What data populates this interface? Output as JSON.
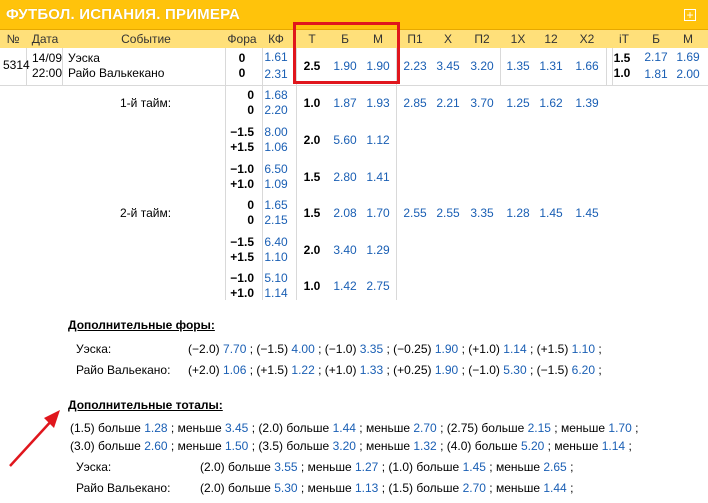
{
  "title": "ФУТБОЛ. ИСПАНИЯ. ПРИМЕРА",
  "header": [
    "№",
    "Дата",
    "Событие",
    "Фора",
    "КФ",
    "Т",
    "Б",
    "М",
    "П1",
    "Х",
    "П2",
    "1Х",
    "12",
    "Х2",
    "iT",
    "Б",
    "М"
  ],
  "event": {
    "id": "5314",
    "date": "14/09",
    "time": "22:00",
    "team1": "Уэска",
    "team2": "Райо Валькекано",
    "fora1": "0",
    "fora2": "0",
    "kf1": "1.61",
    "kf2": "2.31",
    "t": "2.5",
    "b": "1.90",
    "m": "1.90",
    "p1": "2.23",
    "x": "3.45",
    "p2": "3.20",
    "x1": "1.35",
    "x12": "1.31",
    "x2": "1.66",
    "it1": "1.5",
    "it2": "1.0",
    "ib1": "2.17",
    "ib2": "1.81",
    "im1": "1.69",
    "im2": "2.00"
  },
  "half1_label": "1-й тайм:",
  "half2_label": "2-й тайм:",
  "subrows": [
    {
      "f1": "0",
      "f2": "0",
      "k1": "1.68",
      "k2": "2.20",
      "t": "1.0",
      "b": "1.87",
      "m": "1.93",
      "p1": "2.85",
      "x": "2.21",
      "p2": "3.70",
      "x1": "1.25",
      "x12": "1.62",
      "x2": "1.39"
    },
    {
      "f1": "−1.5",
      "f2": "+1.5",
      "k1": "8.00",
      "k2": "1.06",
      "t": "2.0",
      "b": "5.60",
      "m": "1.12"
    },
    {
      "f1": "−1.0",
      "f2": "+1.0",
      "k1": "6.50",
      "k2": "1.09",
      "t": "1.5",
      "b": "2.80",
      "m": "1.41"
    },
    {
      "f1": "0",
      "f2": "0",
      "k1": "1.65",
      "k2": "2.15",
      "t": "1.5",
      "b": "2.08",
      "m": "1.70",
      "p1": "2.55",
      "x": "2.55",
      "p2": "3.35",
      "x1": "1.28",
      "x12": "1.45",
      "x2": "1.45"
    },
    {
      "f1": "−1.5",
      "f2": "+1.5",
      "k1": "6.40",
      "k2": "1.10",
      "t": "2.0",
      "b": "3.40",
      "m": "1.29"
    },
    {
      "f1": "−1.0",
      "f2": "+1.0",
      "k1": "5.10",
      "k2": "1.14",
      "t": "1.0",
      "b": "1.42",
      "m": "2.75"
    }
  ],
  "extra_fora": {
    "title": "Дополнительные форы:",
    "rows": [
      {
        "team": "Уэска:",
        "items": [
          [
            "(−2.0)",
            "7.70"
          ],
          [
            "(−1.5)",
            "4.00"
          ],
          [
            "(−1.0)",
            "3.35"
          ],
          [
            "(−0.25)",
            "1.90"
          ],
          [
            "(+1.0)",
            "1.14"
          ],
          [
            "(+1.5)",
            "1.10"
          ]
        ]
      },
      {
        "team": "Райо Вальекано:",
        "items": [
          [
            "(+2.0)",
            "1.06"
          ],
          [
            "(+1.5)",
            "1.22"
          ],
          [
            "(+1.0)",
            "1.33"
          ],
          [
            "(+0.25)",
            "1.90"
          ],
          [
            "(−1.0)",
            "5.30"
          ],
          [
            "(−1.5)",
            "6.20"
          ]
        ]
      }
    ]
  },
  "extra_totals": {
    "title": "Дополнительные тоталы:",
    "line1": [
      [
        "(1.5) больше",
        "1.28"
      ],
      [
        "меньше",
        "3.45"
      ],
      [
        "(2.0) больше",
        "1.44"
      ],
      [
        "меньше",
        "2.70"
      ],
      [
        "(2.75) больше",
        "2.15"
      ],
      [
        "меньше",
        "1.70"
      ]
    ],
    "line2": [
      [
        "(3.0) больше",
        "2.60"
      ],
      [
        "меньше",
        "1.50"
      ],
      [
        "(3.5) больше",
        "3.20"
      ],
      [
        "меньше",
        "1.32"
      ],
      [
        "(4.0) больше",
        "5.20"
      ],
      [
        "меньше",
        "1.14"
      ]
    ],
    "team_rows": [
      {
        "team": "Уэска:",
        "items": [
          [
            "(2.0) больше",
            "3.55"
          ],
          [
            "меньше",
            "1.27"
          ],
          [
            "(1.0) больше",
            "1.45"
          ],
          [
            "меньше",
            "2.65"
          ]
        ]
      },
      {
        "team": "Райо Вальекано:",
        "items": [
          [
            "(2.0) больше",
            "5.30"
          ],
          [
            "меньше",
            "1.13"
          ],
          [
            "(1.5) больше",
            "2.70"
          ],
          [
            "меньше",
            "1.44"
          ]
        ]
      }
    ]
  },
  "colors": {
    "accent": "#ffc30b",
    "header_bg": "#ffe07a",
    "link": "#1a5fb4",
    "highlight": "#e0161d"
  }
}
